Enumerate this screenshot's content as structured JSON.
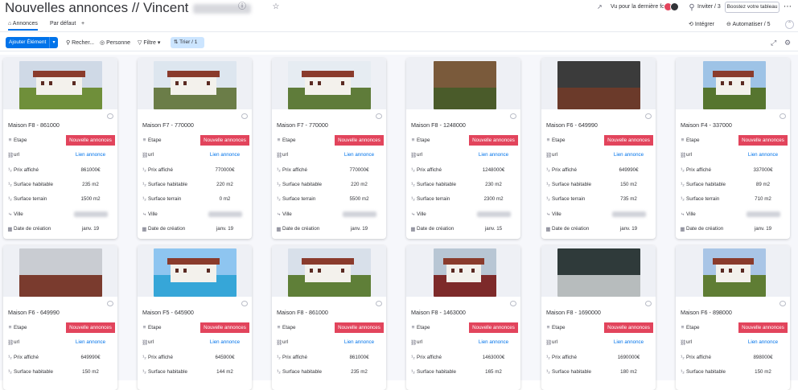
{
  "header": {
    "title": "Nouvelles annonces // Vincent",
    "seen_label": "Vu pour la dernière fois",
    "invite_label": "Inviter / 3",
    "boost_label": "Boostez votre tableau"
  },
  "tabs": {
    "items": [
      "Annonces",
      "Par défaut"
    ],
    "add": "+",
    "integrate": "Intégrer",
    "automate": "Automatiser / 5"
  },
  "toolbar": {
    "add_label": "Ajouter Élément",
    "search": "Recher...",
    "person": "Personne",
    "filter": "Filtre",
    "sort": "Trier / 1"
  },
  "field_labels": {
    "etape": "Etape",
    "url": "url",
    "prix": "Prix affiché",
    "surface_hab": "Surface habitable",
    "surface_terrain": "Surface terrain",
    "ville": "Ville",
    "date": "Date de création"
  },
  "icons": {
    "etape": "status-icon",
    "url": "link-icon",
    "prix": "numbers-icon",
    "surface": "numbers-icon",
    "ville": "location-icon",
    "date": "calendar-icon"
  },
  "colors": {
    "status_red": "#e2445c",
    "accent_blue": "#0073ea"
  },
  "cards_row1": [
    {
      "name": "Maison F8 - 861000",
      "etape": "Nouvelle annonces",
      "url": "Lien annonce",
      "prix": "861000€",
      "surface_hab": "235 m2",
      "surface_terrain": "1500 m2",
      "date": "janv. 19"
    },
    {
      "name": "Maison F7 - 770000",
      "etape": "Nouvelle annonces",
      "url": "Lien annonce",
      "prix": "770000€",
      "surface_hab": "220 m2",
      "surface_terrain": "0 m2",
      "date": "janv. 19"
    },
    {
      "name": "Maison F7 - 770000",
      "etape": "Nouvelle annonces",
      "url": "Lien annonce",
      "prix": "770000€",
      "surface_hab": "220 m2",
      "surface_terrain": "5500 m2",
      "date": "janv. 19"
    },
    {
      "name": "Maison F8 - 1248000",
      "etape": "Nouvelle annonces",
      "url": "Lien annonce",
      "prix": "1248000€",
      "surface_hab": "230 m2",
      "surface_terrain": "2300 m2",
      "date": "janv. 15"
    },
    {
      "name": "Maison F6 - 649990",
      "etape": "Nouvelle annonces",
      "url": "Lien annonce",
      "prix": "649990€",
      "surface_hab": "150 m2",
      "surface_terrain": "735 m2",
      "date": "janv. 19"
    },
    {
      "name": "Maison F4 - 337000",
      "etape": "Nouvelle annonces",
      "url": "Lien annonce",
      "prix": "337000€",
      "surface_hab": "89 m2",
      "surface_terrain": "710 m2",
      "date": "janv. 19"
    }
  ],
  "cards_row2": [
    {
      "name": "Maison F6 - 649990",
      "etape": "Nouvelle annonces",
      "url": "Lien annonce",
      "prix": "649990€",
      "surface_hab": "150 m2"
    },
    {
      "name": "Maison F5 - 645900",
      "etape": "Nouvelle annonces",
      "url": "Lien annonce",
      "prix": "645900€",
      "surface_hab": "144 m2"
    },
    {
      "name": "Maison F8 - 861000",
      "etape": "Nouvelle annonces",
      "url": "Lien annonce",
      "prix": "861000€",
      "surface_hab": "235 m2"
    },
    {
      "name": "Maison F8 - 1463000",
      "etape": "Nouvelle annonces",
      "url": "Lien annonce",
      "prix": "1463000€",
      "surface_hab": "165 m2"
    },
    {
      "name": "Maison F8 - 1690000",
      "etape": "Nouvelle annonces",
      "url": "Lien annonce",
      "prix": "1690000€",
      "surface_hab": "180 m2"
    },
    {
      "name": "Maison F6 - 898000",
      "etape": "Nouvelle annonces",
      "url": "Lien annonce",
      "prix": "898000€",
      "surface_hab": "150 m2"
    }
  ]
}
